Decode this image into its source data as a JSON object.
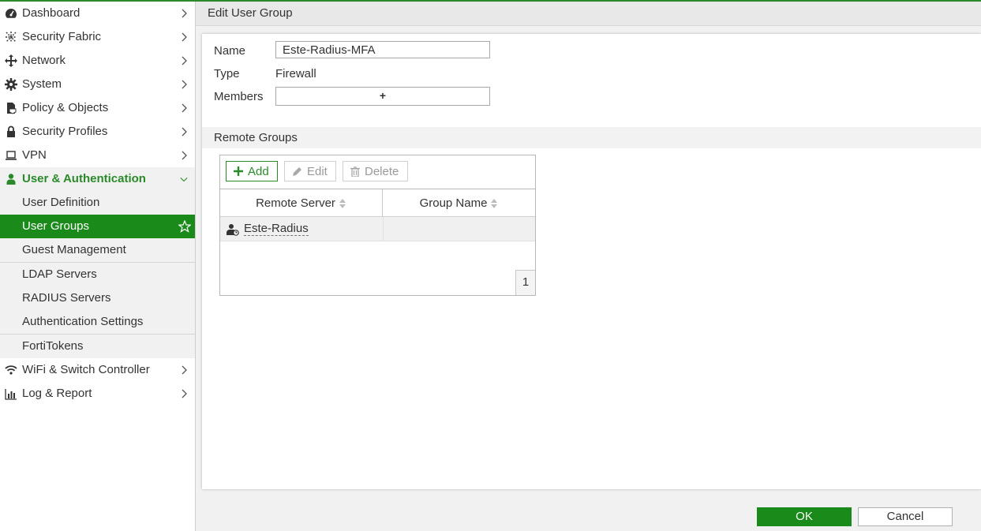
{
  "sidebar": {
    "items": [
      {
        "label": "Dashboard",
        "icon": "dashboard-icon"
      },
      {
        "label": "Security Fabric",
        "icon": "security-fabric-icon"
      },
      {
        "label": "Network",
        "icon": "network-icon"
      },
      {
        "label": "System",
        "icon": "gear-icon"
      },
      {
        "label": "Policy & Objects",
        "icon": "policy-icon"
      },
      {
        "label": "Security Profiles",
        "icon": "lock-icon"
      },
      {
        "label": "VPN",
        "icon": "laptop-icon"
      },
      {
        "label": "User & Authentication",
        "icon": "user-icon"
      }
    ],
    "subitems": [
      {
        "label": "User Definition"
      },
      {
        "label": "User Groups"
      },
      {
        "label": "Guest Management"
      },
      {
        "label": "LDAP Servers"
      },
      {
        "label": "RADIUS Servers"
      },
      {
        "label": "Authentication Settings"
      },
      {
        "label": "FortiTokens"
      }
    ],
    "bottom_items": [
      {
        "label": "WiFi & Switch Controller",
        "icon": "wifi-icon"
      },
      {
        "label": "Log & Report",
        "icon": "bar-chart-icon"
      }
    ]
  },
  "header": {
    "title": "Edit User Group"
  },
  "form": {
    "name_label": "Name",
    "name_value": "Este-Radius-MFA",
    "type_label": "Type",
    "type_value": "Firewall",
    "members_label": "Members",
    "members_add": "+"
  },
  "remote_groups": {
    "title": "Remote Groups",
    "toolbar": {
      "add": "Add",
      "edit": "Edit",
      "delete": "Delete"
    },
    "columns": [
      "Remote Server",
      "Group Name"
    ],
    "rows": [
      {
        "server": "Este-Radius",
        "group": ""
      }
    ],
    "page": "1"
  },
  "footer": {
    "ok": "OK",
    "cancel": "Cancel"
  },
  "colors": {
    "accent": "#1a8a1a",
    "header": "#e8e8e8"
  }
}
